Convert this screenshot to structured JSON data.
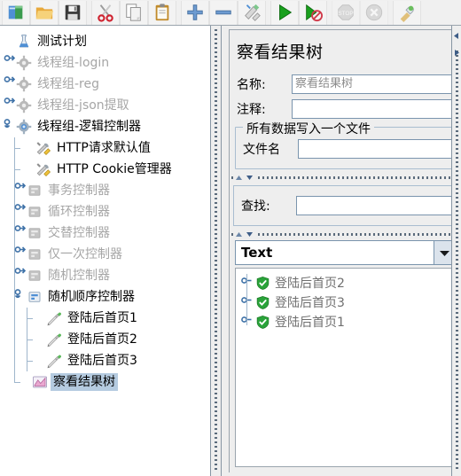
{
  "toolbar": {
    "buttons": [
      {
        "name": "new-test-plan-button",
        "title": "New",
        "icon": "new-document-icon",
        "enabled": true
      },
      {
        "name": "open-button",
        "title": "Open",
        "icon": "folder-open-icon",
        "enabled": true
      },
      {
        "name": "save-button",
        "title": "Save",
        "icon": "floppy-save-icon",
        "enabled": true
      },
      {
        "name": "cut-button",
        "title": "Cut",
        "icon": "scissors-icon",
        "enabled": true
      },
      {
        "name": "copy-button",
        "title": "Copy",
        "icon": "copy-pages-icon",
        "enabled": true
      },
      {
        "name": "paste-button",
        "title": "Paste",
        "icon": "clipboard-icon",
        "enabled": true
      },
      {
        "name": "expand-all-button",
        "title": "Expand All",
        "icon": "plus-icon",
        "enabled": true
      },
      {
        "name": "collapse-all-button",
        "title": "Collapse All",
        "icon": "minus-icon",
        "enabled": true
      },
      {
        "name": "toggle-button",
        "title": "Toggle",
        "icon": "toggle-pencils-icon",
        "enabled": true
      },
      {
        "name": "start-button",
        "title": "Start",
        "icon": "play-triangle-icon",
        "enabled": true
      },
      {
        "name": "start-no-pauses-button",
        "title": "Start no pauses",
        "icon": "play-no-pause-icon",
        "enabled": true
      },
      {
        "name": "stop-button",
        "title": "Stop",
        "icon": "stop-sign-icon",
        "enabled": false
      },
      {
        "name": "shutdown-button",
        "title": "Shutdown",
        "icon": "shutdown-x-icon",
        "enabled": false
      },
      {
        "name": "clear-all-button",
        "title": "Clear All",
        "icon": "broom-icon",
        "enabled": true
      }
    ]
  },
  "tree": {
    "items": [
      {
        "label": "测试计划",
        "icon": "test-plan-beaker-icon",
        "indent": 4,
        "handle": "none",
        "state": "normal",
        "guide": "none",
        "name": "tree-item-test-plan"
      },
      {
        "label": "线程组-login",
        "icon": "thread-group-gear-icon",
        "indent": 4,
        "handle": "collapsed",
        "state": "disabled",
        "guide": "none",
        "name": "tree-item-thread-group-login"
      },
      {
        "label": "线程组-reg",
        "icon": "thread-group-gear-icon",
        "indent": 4,
        "handle": "collapsed",
        "state": "disabled",
        "guide": "none",
        "name": "tree-item-thread-group-reg"
      },
      {
        "label": "线程组-json提取",
        "icon": "thread-group-gear-icon",
        "indent": 4,
        "handle": "collapsed",
        "state": "disabled",
        "guide": "none",
        "name": "tree-item-thread-group-json"
      },
      {
        "label": "线程组-逻辑控制器",
        "icon": "thread-group-gear-active-icon",
        "indent": 4,
        "handle": "expanded",
        "state": "normal",
        "guide": "none",
        "name": "tree-item-thread-group-logic-controller"
      },
      {
        "label": "HTTP请求默认值",
        "icon": "http-defaults-tools-icon",
        "indent": 26,
        "handle": "leaf",
        "state": "normal",
        "guide": "child",
        "name": "tree-item-http-request-defaults"
      },
      {
        "label": "HTTP Cookie管理器",
        "icon": "http-cookie-tools-icon",
        "indent": 26,
        "handle": "leaf",
        "state": "normal",
        "guide": "child",
        "name": "tree-item-http-cookie-manager"
      },
      {
        "label": "事务控制器",
        "icon": "controller-icon",
        "indent": 16,
        "handle": "collapsed",
        "state": "disabled",
        "guide": "trunk",
        "name": "tree-item-transaction-controller"
      },
      {
        "label": "循环控制器",
        "icon": "controller-icon",
        "indent": 16,
        "handle": "collapsed",
        "state": "disabled",
        "guide": "trunk",
        "name": "tree-item-loop-controller"
      },
      {
        "label": "交替控制器",
        "icon": "controller-icon",
        "indent": 16,
        "handle": "collapsed",
        "state": "disabled",
        "guide": "trunk",
        "name": "tree-item-interleave-controller"
      },
      {
        "label": "仅一次控制器",
        "icon": "controller-icon",
        "indent": 16,
        "handle": "collapsed",
        "state": "disabled",
        "guide": "trunk",
        "name": "tree-item-once-only-controller"
      },
      {
        "label": "随机控制器",
        "icon": "controller-icon",
        "indent": 16,
        "handle": "collapsed",
        "state": "disabled",
        "guide": "trunk",
        "name": "tree-item-random-controller"
      },
      {
        "label": "随机顺序控制器",
        "icon": "controller-active-icon",
        "indent": 16,
        "handle": "expanded",
        "state": "normal",
        "guide": "trunk",
        "name": "tree-item-random-order-controller"
      },
      {
        "label": "登陆后首页1",
        "icon": "http-sampler-pen-icon",
        "indent": 38,
        "handle": "leaf",
        "state": "normal",
        "guide": "child2",
        "name": "tree-item-sampler-home-1"
      },
      {
        "label": "登陆后首页2",
        "icon": "http-sampler-pen-icon",
        "indent": 38,
        "handle": "leaf",
        "state": "normal",
        "guide": "child2",
        "name": "tree-item-sampler-home-2"
      },
      {
        "label": "登陆后首页3",
        "icon": "http-sampler-pen-icon",
        "indent": 38,
        "handle": "leaf",
        "state": "normal",
        "guide": "child2",
        "name": "tree-item-sampler-home-3"
      },
      {
        "label": "察看结果树",
        "icon": "view-results-tree-chart-icon",
        "indent": 22,
        "handle": "leaf",
        "state": "selected",
        "guide": "lastchild",
        "name": "tree-item-view-results-tree"
      }
    ]
  },
  "panel": {
    "title": "察看结果树",
    "name_label": "名称:",
    "name_value": "察看结果树",
    "comment_label": "注释:",
    "comment_value": "",
    "file_group_title": "所有数据写入一个文件",
    "filename_label": "文件名",
    "filename_value": "",
    "search_label": "查找:",
    "search_value": "",
    "renderer_selected": "Text",
    "renderer_options": [
      "Text"
    ],
    "results": [
      {
        "label": "登陆后首页2",
        "status": "success",
        "name": "result-item"
      },
      {
        "label": "登陆后首页3",
        "status": "success",
        "name": "result-item"
      },
      {
        "label": "登陆后首页1",
        "status": "success",
        "name": "result-item"
      }
    ]
  },
  "colors": {
    "selection": "#b5cbe0",
    "success": "#2ca02c",
    "panel_bg": "#eeeeee",
    "field_border": "#7a94ad",
    "disabled_text": "#a6a6a6"
  }
}
